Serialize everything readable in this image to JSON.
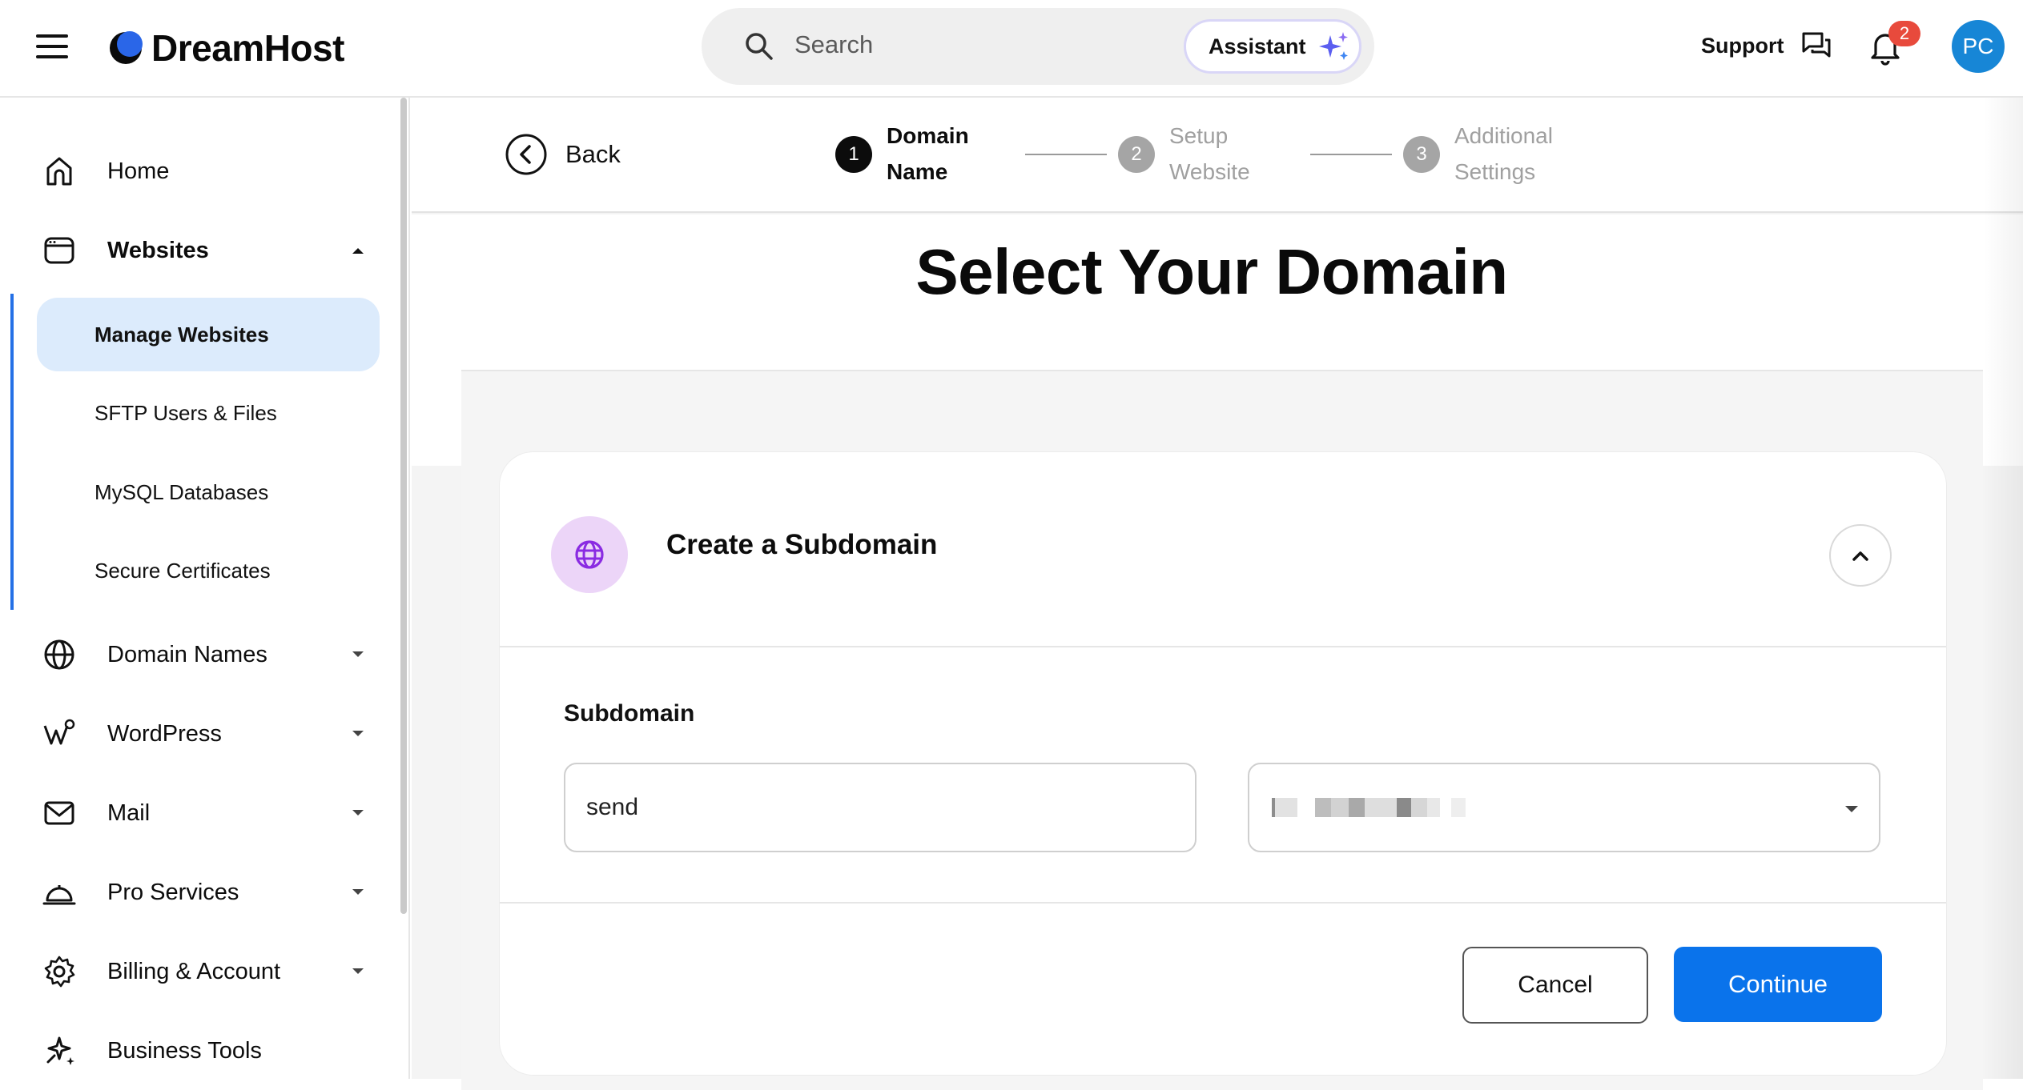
{
  "brand": {
    "name": "DreamHost",
    "accent": "#0a73eb"
  },
  "header": {
    "search_placeholder": "Search",
    "assistant_label": "Assistant",
    "support_label": "Support",
    "notification_count": "2",
    "avatar_initials": "PC"
  },
  "sidebar": {
    "items": [
      {
        "label": "Home",
        "icon": "home-icon"
      },
      {
        "label": "Websites",
        "icon": "browser-window-icon",
        "expanded": true
      },
      {
        "label": "Domain Names",
        "icon": "globe-icon"
      },
      {
        "label": "WordPress",
        "icon": "wordpress-icon"
      },
      {
        "label": "Mail",
        "icon": "mail-icon"
      },
      {
        "label": "Pro Services",
        "icon": "service-bell-icon"
      },
      {
        "label": "Billing & Account",
        "icon": "gear-icon"
      },
      {
        "label": "Business Tools",
        "icon": "sparkle-tools-icon"
      }
    ],
    "website_subitems": [
      {
        "label": "Manage Websites",
        "active": true
      },
      {
        "label": "SFTP Users & Files"
      },
      {
        "label": "MySQL Databases"
      },
      {
        "label": "Secure Certificates"
      }
    ]
  },
  "wizard": {
    "back_label": "Back",
    "steps": [
      {
        "num": "1",
        "line1": "Domain",
        "line2": "Name",
        "active": true
      },
      {
        "num": "2",
        "line1": "Setup",
        "line2": "Website",
        "active": false
      },
      {
        "num": "3",
        "line1": "Additional",
        "line2": "Settings",
        "active": false
      }
    ]
  },
  "page": {
    "title": "Select Your Domain",
    "card_title": "Create a Subdomain",
    "field_label": "Subdomain",
    "subdomain_value": "send",
    "domain_value_redacted": true,
    "cancel_label": "Cancel",
    "continue_label": "Continue"
  }
}
